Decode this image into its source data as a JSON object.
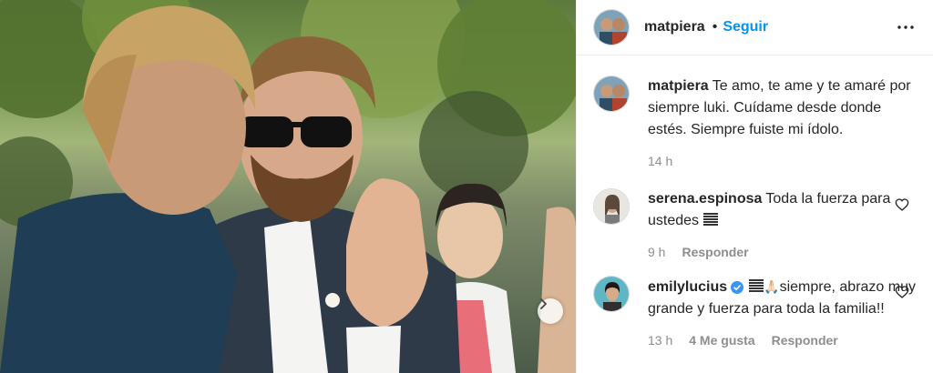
{
  "post": {
    "author": "matpiera",
    "separator": "•",
    "follow_label": "Seguir",
    "caption": "Te amo, te ame y te amaré por siempre luki. Cuídame desde donde estés. Siempre fuiste mi ídolo.",
    "caption_time": "14 h"
  },
  "comments": [
    {
      "user": "serena.espinosa",
      "text": "Toda la fuerza para ustedes",
      "time": "9 h",
      "reply_label": "Responder"
    },
    {
      "user": "emilylucius",
      "verified": true,
      "text": "siempre, abrazo muy grande y fuerza para toda la familia!!",
      "time": "13 h",
      "likes": "4 Me gusta",
      "reply_label": "Responder"
    }
  ],
  "colors": {
    "link_blue": "#0095f6",
    "verified_blue": "#3897f0",
    "meta_gray": "#8e8e8e",
    "text": "#262626"
  },
  "icons": {
    "more": "more-horizontal-icon",
    "like": "heart-outline-icon",
    "next": "chevron-right-icon",
    "verified": "verified-badge-icon"
  }
}
